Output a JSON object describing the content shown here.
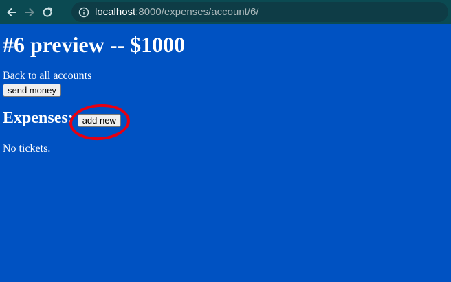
{
  "browser": {
    "url_host": "localhost",
    "url_path": ":8000/expenses/account/6/"
  },
  "page": {
    "title": "#6 preview -- $1000",
    "back_link": "Back to all accounts",
    "send_money_label": "send money",
    "expenses_heading": "Expenses:",
    "add_new_label": "add new",
    "empty_text": "No tickets."
  },
  "colors": {
    "background": "#0052c2",
    "annotation_circle": "#e60012"
  }
}
